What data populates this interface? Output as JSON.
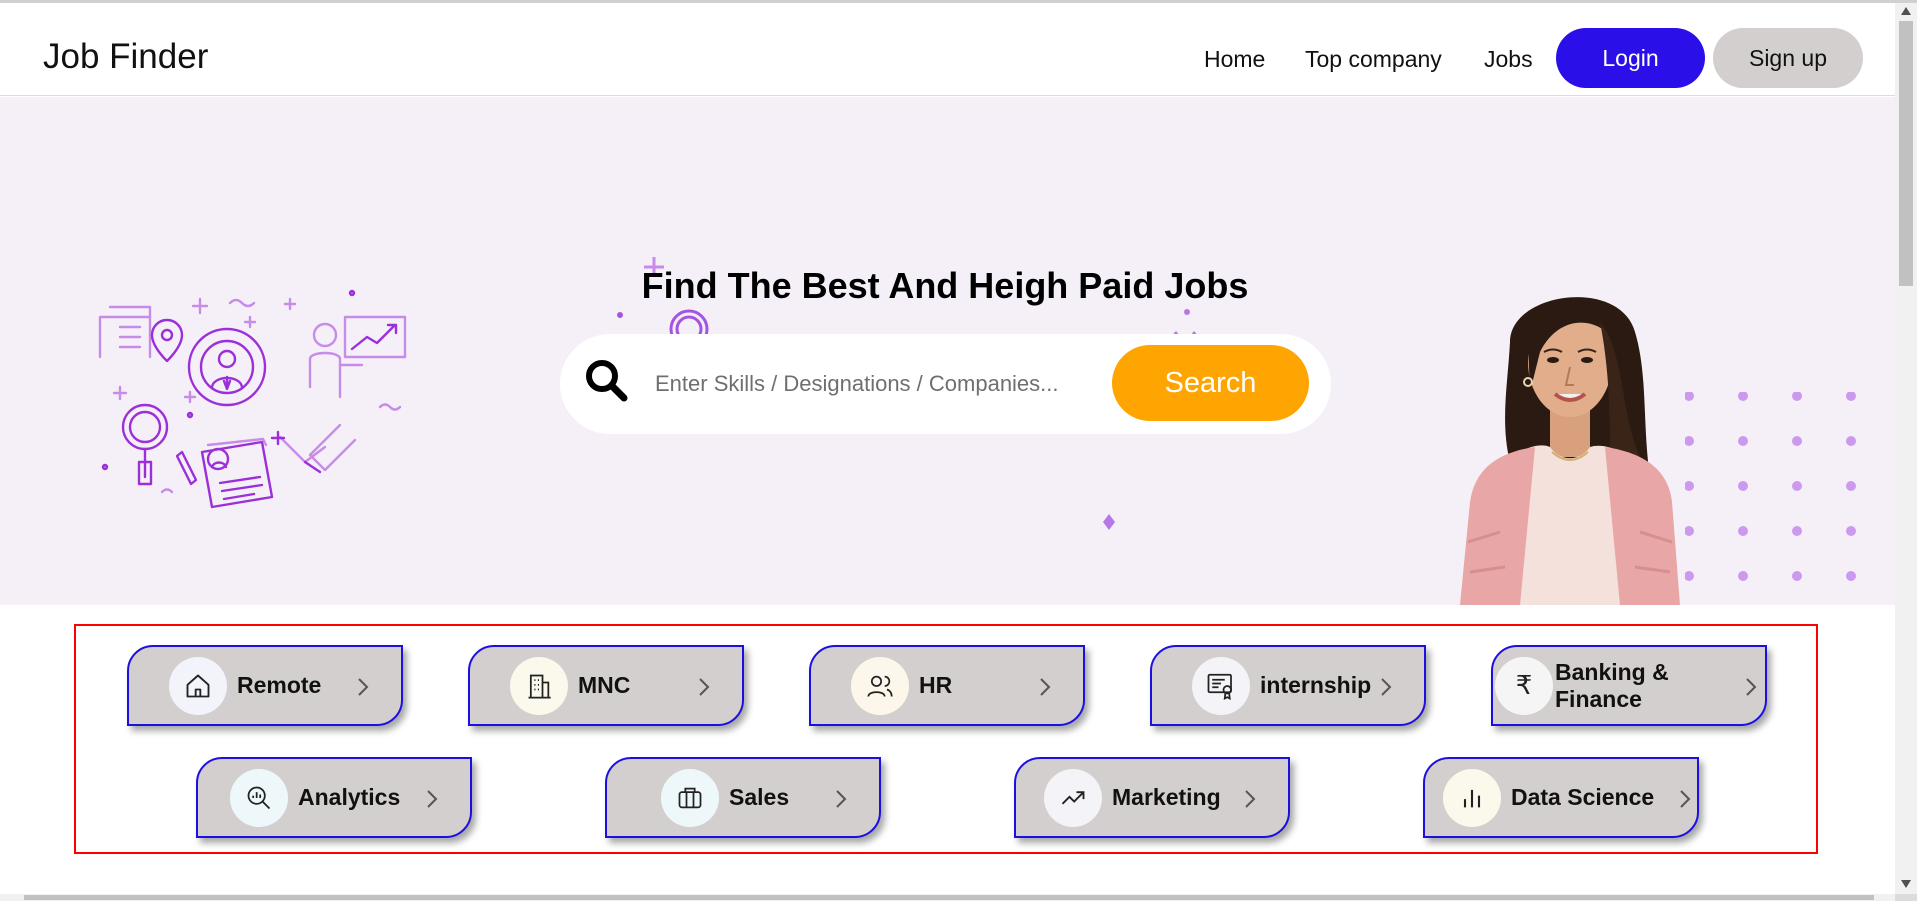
{
  "brand": "Job Finder",
  "nav": {
    "home": "Home",
    "top_company": "Top company",
    "jobs": "Jobs",
    "login": "Login",
    "signup": "Sign up"
  },
  "hero": {
    "title": "Find The Best And Heigh Paid Jobs",
    "search_placeholder": "Enter Skills / Designations / Companies...",
    "search_button": "Search"
  },
  "categories": [
    {
      "label": "Remote",
      "icon": "home-icon"
    },
    {
      "label": "MNC",
      "icon": "building-icon"
    },
    {
      "label": "HR",
      "icon": "users-icon"
    },
    {
      "label": "internship",
      "icon": "certificate-icon"
    },
    {
      "label": "Banking & Finance",
      "icon": "rupee-icon"
    },
    {
      "label": "Analytics",
      "icon": "analytics-icon"
    },
    {
      "label": "Sales",
      "icon": "briefcase-icon"
    },
    {
      "label": "Marketing",
      "icon": "trend-up-icon"
    },
    {
      "label": "Data Science",
      "icon": "bar-chart-icon"
    }
  ],
  "colors": {
    "accent": "#2a0fe8",
    "search_button": "#ffa502",
    "hero_bg": "#f5f0f8",
    "chip_bg": "#d4cfcf",
    "chip_border": "#1c0fe0",
    "category_box_border": "#ff0000",
    "illustration": "#9b30d9"
  }
}
